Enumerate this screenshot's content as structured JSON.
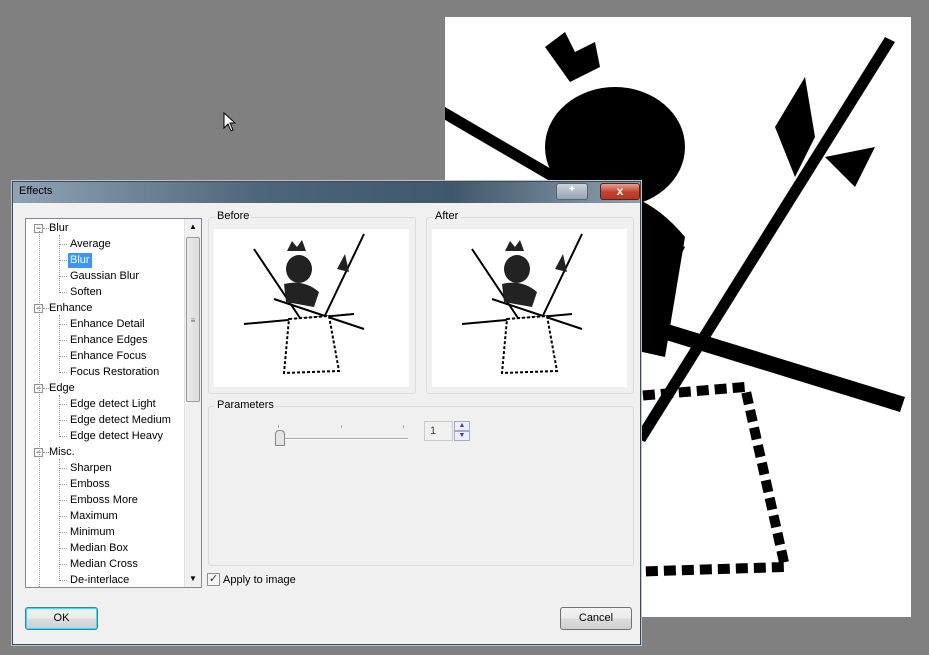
{
  "window": {
    "title": "Effects",
    "pin_icon": "pin-icon",
    "close_label": "x"
  },
  "tree": {
    "groups": [
      {
        "label": "Blur",
        "items": [
          "Average",
          "Blur",
          "Gaussian Blur",
          "Soften"
        ]
      },
      {
        "label": "Enhance",
        "items": [
          "Enhance Detail",
          "Enhance Edges",
          "Enhance Focus",
          "Focus Restoration"
        ]
      },
      {
        "label": "Edge",
        "items": [
          "Edge detect Light",
          "Edge detect Medium",
          "Edge detect Heavy"
        ]
      },
      {
        "label": "Misc.",
        "items": [
          "Sharpen",
          "Emboss",
          "Emboss More",
          "Maximum",
          "Minimum",
          "Median Box",
          "Median Cross",
          "De-interlace"
        ]
      }
    ],
    "selected": "Blur"
  },
  "preview": {
    "before_label": "Before",
    "after_label": "After"
  },
  "parameters": {
    "label": "Parameters",
    "slider_value": 1,
    "value": "1"
  },
  "apply": {
    "label": "Apply to image",
    "checked": true
  },
  "buttons": {
    "ok": "OK",
    "cancel": "Cancel"
  }
}
